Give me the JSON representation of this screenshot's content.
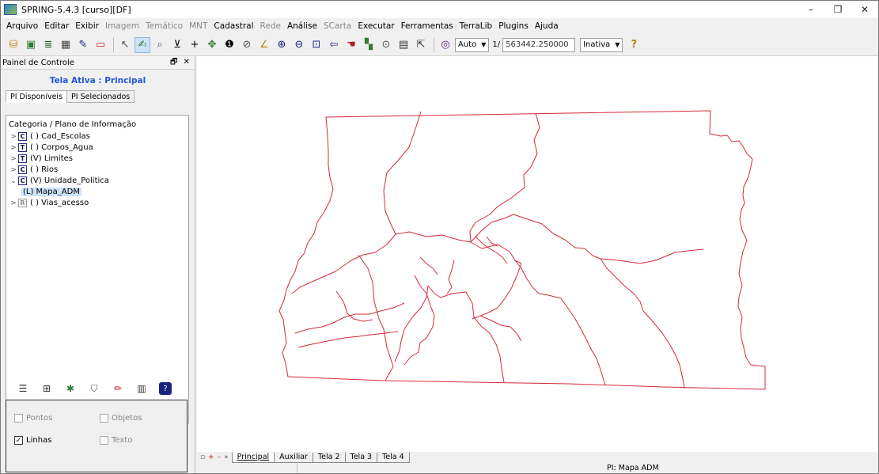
{
  "window": {
    "title": "SPRING-5.4.3 [curso][DF]",
    "controls": [
      "–",
      "❐",
      "✕"
    ]
  },
  "menu": {
    "items": [
      {
        "label": "Arquivo",
        "enabled": true
      },
      {
        "label": "Editar",
        "enabled": true
      },
      {
        "label": "Exibir",
        "enabled": true
      },
      {
        "label": "Imagem",
        "enabled": false
      },
      {
        "label": "Temático",
        "enabled": false
      },
      {
        "label": "MNT",
        "enabled": false
      },
      {
        "label": "Cadastral",
        "enabled": true
      },
      {
        "label": "Rede",
        "enabled": false
      },
      {
        "label": "Análise",
        "enabled": true
      },
      {
        "label": "SCarta",
        "enabled": false
      },
      {
        "label": "Executar",
        "enabled": true
      },
      {
        "label": "Ferramentas",
        "enabled": true
      },
      {
        "label": "TerraLib",
        "enabled": true
      },
      {
        "label": "Plugins",
        "enabled": true
      },
      {
        "label": "Ajuda",
        "enabled": true
      }
    ]
  },
  "toolbar": {
    "mode_value": "Auto",
    "scale_prefix": "1/",
    "scale_value": "563442.250000",
    "state_value": "Inativa"
  },
  "panel": {
    "title": "Painel de Controle",
    "header_buttons": "🗗 ✕",
    "active_screen": "Tela Ativa : Principal",
    "tabs": [
      "PI Disponíveis",
      "PI Selecionados"
    ],
    "tree_header": "Categoria / Plano de Informação",
    "categories": [
      {
        "type": "C",
        "label": "( ) Cad_Escolas",
        "expanded": false
      },
      {
        "type": "T",
        "label": "( ) Corpos_Agua",
        "expanded": false
      },
      {
        "type": "T",
        "label": "(V) Limites",
        "expanded": false
      },
      {
        "type": "C",
        "label": "( ) Rios",
        "expanded": false
      },
      {
        "type": "C",
        "label": "(V) Unidade_Politica",
        "expanded": true
      },
      {
        "type": "R",
        "label": "( ) Vias_acesso",
        "expanded": false
      }
    ],
    "selected_plan": "(L) Mapa_ADM",
    "options": [
      {
        "label": "Pontos",
        "checked": false
      },
      {
        "label": "Objetos",
        "checked": false
      },
      {
        "label": "Linhas",
        "checked": true
      },
      {
        "label": "Texto",
        "checked": false
      }
    ]
  },
  "screen_tabs": [
    "Principal",
    "Auxiliar",
    "Tela 2",
    "Tela 3",
    "Tela 4"
  ],
  "status": {
    "pi": "PI: Mapa ADM"
  },
  "map": {
    "line_color": "#d42a3a"
  }
}
